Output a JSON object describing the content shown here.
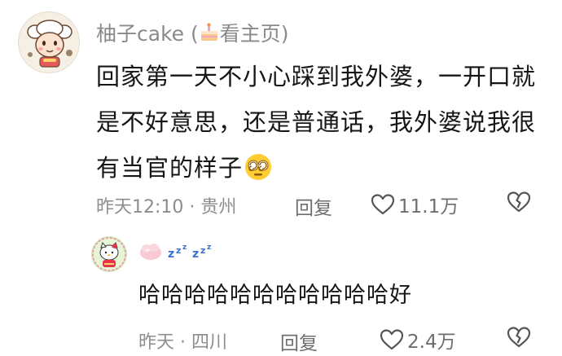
{
  "comment": {
    "username": "柚子cake",
    "profile_prefix": "(",
    "profile_label": "看主页",
    "profile_suffix": ")",
    "text": "回家第一天不小心踩到我外婆，一开口就是不好意思，还是普通话，我外婆说我很有当官的样子",
    "emoji_icon": "dizzy-face-emoji",
    "time": "昨天12:10 · 贵州",
    "reply_label": "回复",
    "likes": "11.1万"
  },
  "reply": {
    "avatar_icon": "hello-kitty-avatar",
    "name_icons": [
      "pink-blob-emoji",
      "zzz-sleep-icon"
    ],
    "text": "哈哈哈哈哈哈哈哈哈哈哈好",
    "time": "昨天 · 四川",
    "reply_label": "回复",
    "likes": "2.4万"
  },
  "colors": {
    "meta_gray": "#8d8d8d",
    "text_black": "#161616",
    "zzz_blue": "#3b6fd4"
  }
}
